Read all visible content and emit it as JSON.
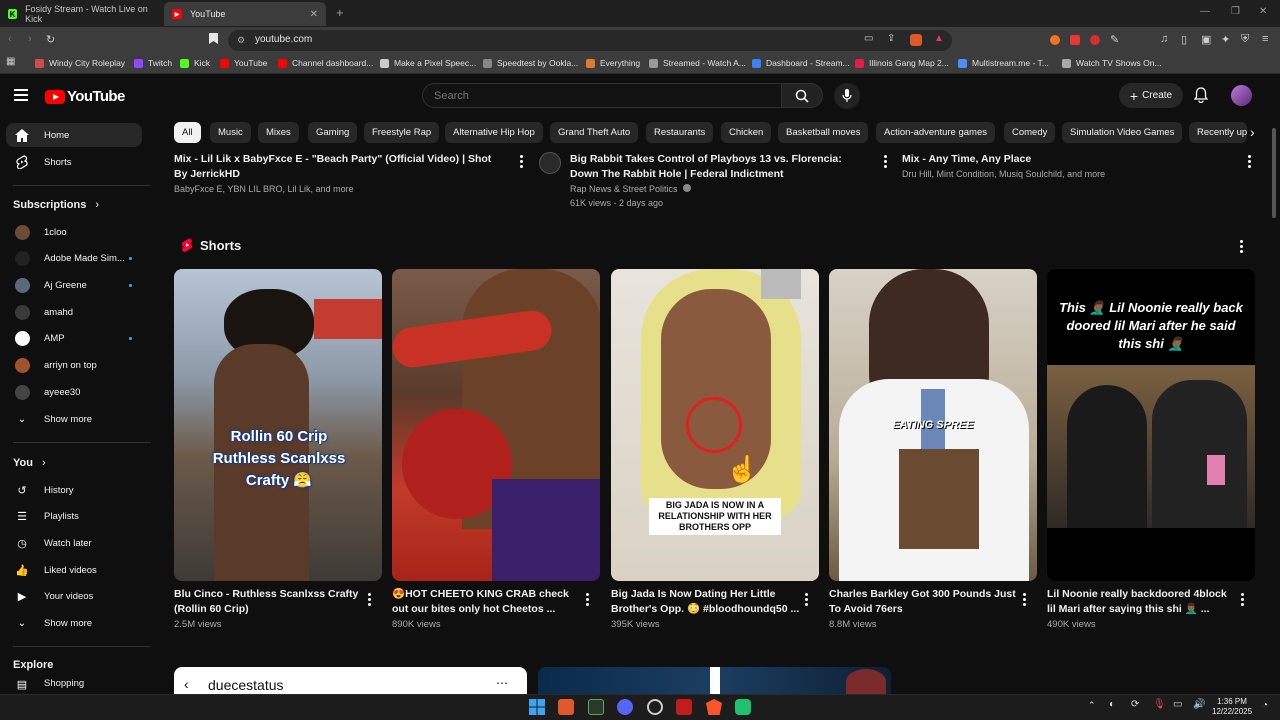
{
  "browser": {
    "tabs": [
      {
        "label": "Fosidy Stream - Watch Live on Kick",
        "fav_color": "#53fc18",
        "fav_char": "K"
      },
      {
        "label": "YouTube",
        "fav_color": "#ff0000",
        "fav_char": "▶"
      }
    ],
    "url": "youtube.com",
    "bookmarks": [
      {
        "label": "Windy City Roleplay",
        "color": "#d24b4b"
      },
      {
        "label": "Twitch",
        "color": "#9146ff"
      },
      {
        "label": "Kick",
        "color": "#53fc18"
      },
      {
        "label": "YouTube",
        "color": "#ff0000"
      },
      {
        "label": "Channel dashboard...",
        "color": "#ff0000"
      },
      {
        "label": "Make a Pixel Speec...",
        "color": "#cccccc"
      },
      {
        "label": "Speedtest by Ookla...",
        "color": "#888888"
      },
      {
        "label": "Everything",
        "color": "#e07a2f"
      },
      {
        "label": "Streamed - Watch A...",
        "color": "#999999"
      },
      {
        "label": "Dashboard - Stream...",
        "color": "#3b82f6"
      },
      {
        "label": "Illinois Gang Map 2...",
        "color": "#e11d48"
      },
      {
        "label": "Multistream.me - T...",
        "color": "#4f8ef7"
      },
      {
        "label": "Watch TV Shows On...",
        "color": "#aaaaaa"
      }
    ]
  },
  "header": {
    "logo_text": "YouTube",
    "search_placeholder": "Search",
    "create_label": "Create"
  },
  "sidebar": {
    "main": [
      {
        "label": "Home",
        "icon": "home-icon",
        "active": true
      },
      {
        "label": "Shorts",
        "icon": "shorts-icon",
        "active": false
      }
    ],
    "subscriptions_heading": "Subscriptions",
    "subscriptions": [
      {
        "label": "1cloo",
        "color": "#6b4a3a",
        "dot": false
      },
      {
        "label": "Adobe Made Sim...",
        "color": "#222222",
        "dot": true
      },
      {
        "label": "Aj Greene",
        "color": "#5a6a7a",
        "dot": true
      },
      {
        "label": "amahd",
        "color": "#3a3a3a",
        "dot": false
      },
      {
        "label": "AMP",
        "color": "#ffffff",
        "dot": true
      },
      {
        "label": "arriyn on top",
        "color": "#a0522d",
        "dot": false
      },
      {
        "label": "ayeee30",
        "color": "#444444",
        "dot": false
      }
    ],
    "show_more_1": "Show more",
    "you_heading": "You",
    "you_items": [
      {
        "label": "History",
        "icon": "history-icon"
      },
      {
        "label": "Playlists",
        "icon": "playlists-icon"
      },
      {
        "label": "Watch later",
        "icon": "watch-later-icon"
      },
      {
        "label": "Liked videos",
        "icon": "like-icon"
      },
      {
        "label": "Your videos",
        "icon": "your-videos-icon"
      }
    ],
    "show_more_2": "Show more",
    "explore_heading": "Explore",
    "explore_first": "Shopping"
  },
  "chips": [
    "All",
    "Music",
    "Mixes",
    "Gaming",
    "Freestyle Rap",
    "Alternative Hip Hop",
    "Grand Theft Auto",
    "Restaurants",
    "Chicken",
    "Basketball moves",
    "Action-adventure games",
    "Comedy",
    "Simulation Video Games",
    "Recently up"
  ],
  "top_videos": [
    {
      "title": "Mix - Lil Lik x BabyFxce E - \"Beach Party\" (Official Video) | Shot By JerrickHD",
      "line1": "BabyFxce E, YBN LIL BRO, Lil Lik, and more",
      "line2": ""
    },
    {
      "title": "Big Rabbit Takes Control of Playboys 13 vs. Florencia: Down The Rabbit Hole | Federal Indictment",
      "line1": "Rap News & Street Politics",
      "line2": "61K views - 2 days ago"
    },
    {
      "title": "Mix - Any Time, Any Place",
      "line1": "Dru Hill, Mint Condition, Musiq Soulchild, and more",
      "line2": ""
    }
  ],
  "shorts_heading": "Shorts",
  "shorts": [
    {
      "title": "Blu Cinco - Ruthless Scanlxss Crafty (Rollin 60 Crip)",
      "views": "2.5M views",
      "overlay": "Rollin 60 Crip\nRuthless Scanlxss\nCrafty 😤"
    },
    {
      "title": "😍HOT CHEETO KING CRAB check out our bites only hot Cheetos ...",
      "views": "890K views",
      "overlay": ""
    },
    {
      "title": "Big Jada Is Now Dating Her Little Brother's Opp. 😳 #bloodhoundq50 ...",
      "views": "395K views",
      "overlay": "BIG JADA IS NOW IN A RELATIONSHIP WITH HER BROTHERS OPP"
    },
    {
      "title": "Charles Barkley Got 300 Pounds Just To Avoid 76ers",
      "views": "8.8M views",
      "overlay": "EATING SPREE"
    },
    {
      "title": "Lil Noonie really backdoored 4block lil Mari after saying this shi 🤦🏾‍♂️ ...",
      "views": "490K views",
      "overlay": "This 🤦🏾‍♂️ Lil Noonie really back doored lil Mari after he said this shi 🤦🏾‍♂️"
    }
  ],
  "next_row": {
    "channel_text": "duecestatus"
  },
  "taskbar": {
    "time": "1:36 PM",
    "date": "12/22/2025"
  }
}
